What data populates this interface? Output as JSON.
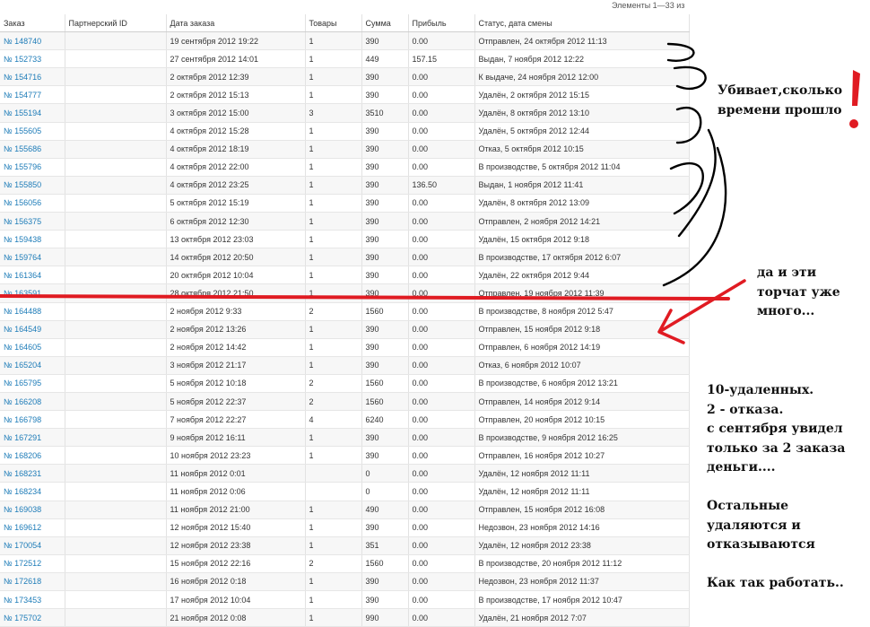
{
  "pager_text": "Элементы 1—33 из",
  "table": {
    "columns": [
      "Заказ",
      "Партнерский ID",
      "Дата заказа",
      "Товары",
      "Сумма",
      "Прибыль",
      "Статус, дата смены"
    ],
    "rows": [
      {
        "order": "№ 148740",
        "partner": "",
        "date": "19 сентября 2012 19:22",
        "items": "1",
        "sum": "390",
        "profit": "0.00",
        "status": "Отправлен, 24 октября 2012 11:13"
      },
      {
        "order": "№ 152733",
        "partner": "",
        "date": "27 сентября 2012 14:01",
        "items": "1",
        "sum": "449",
        "profit": "157.15",
        "status": "Выдан, 7 ноября 2012 12:22"
      },
      {
        "order": "№ 154716",
        "partner": "",
        "date": "2 октября 2012 12:39",
        "items": "1",
        "sum": "390",
        "profit": "0.00",
        "status": "К выдаче, 24 ноября 2012 12:00"
      },
      {
        "order": "№ 154777",
        "partner": "",
        "date": "2 октября 2012 15:13",
        "items": "1",
        "sum": "390",
        "profit": "0.00",
        "status": "Удалён, 2 октября 2012 15:15"
      },
      {
        "order": "№ 155194",
        "partner": "",
        "date": "3 октября 2012 15:00",
        "items": "3",
        "sum": "3510",
        "profit": "0.00",
        "status": "Удалён, 8 октября 2012 13:10"
      },
      {
        "order": "№ 155605",
        "partner": "",
        "date": "4 октября 2012 15:28",
        "items": "1",
        "sum": "390",
        "profit": "0.00",
        "status": "Удалён, 5 октября 2012 12:44"
      },
      {
        "order": "№ 155686",
        "partner": "",
        "date": "4 октября 2012 18:19",
        "items": "1",
        "sum": "390",
        "profit": "0.00",
        "status": "Отказ, 5 октября 2012 10:15"
      },
      {
        "order": "№ 155796",
        "partner": "",
        "date": "4 октября 2012 22:00",
        "items": "1",
        "sum": "390",
        "profit": "0.00",
        "status": "В производстве, 5 октября 2012 11:04"
      },
      {
        "order": "№ 155850",
        "partner": "",
        "date": "4 октября 2012 23:25",
        "items": "1",
        "sum": "390",
        "profit": "136.50",
        "status": "Выдан, 1 ноября 2012 11:41"
      },
      {
        "order": "№ 156056",
        "partner": "",
        "date": "5 октября 2012 15:19",
        "items": "1",
        "sum": "390",
        "profit": "0.00",
        "status": "Удалён, 8 октября 2012 13:09"
      },
      {
        "order": "№ 156375",
        "partner": "",
        "date": "6 октября 2012 12:30",
        "items": "1",
        "sum": "390",
        "profit": "0.00",
        "status": "Отправлен, 2 ноября 2012 14:21"
      },
      {
        "order": "№ 159438",
        "partner": "",
        "date": "13 октября 2012 23:03",
        "items": "1",
        "sum": "390",
        "profit": "0.00",
        "status": "Удалён, 15 октября 2012 9:18"
      },
      {
        "order": "№ 159764",
        "partner": "",
        "date": "14 октября 2012 20:50",
        "items": "1",
        "sum": "390",
        "profit": "0.00",
        "status": "В производстве, 17 октября 2012 6:07"
      },
      {
        "order": "№ 161364",
        "partner": "",
        "date": "20 октября 2012 10:04",
        "items": "1",
        "sum": "390",
        "profit": "0.00",
        "status": "Удалён, 22 октября 2012 9:44"
      },
      {
        "order": "№ 163591",
        "partner": "",
        "date": "28 октября 2012 21:50",
        "items": "1",
        "sum": "390",
        "profit": "0.00",
        "status": "Отправлен, 19 ноября 2012 11:39"
      },
      {
        "order": "№ 164488",
        "partner": "",
        "date": "2 ноября 2012 9:33",
        "items": "2",
        "sum": "1560",
        "profit": "0.00",
        "status": "В производстве, 8 ноября 2012 5:47"
      },
      {
        "order": "№ 164549",
        "partner": "",
        "date": "2 ноября 2012 13:26",
        "items": "1",
        "sum": "390",
        "profit": "0.00",
        "status": "Отправлен, 15 ноября 2012 9:18"
      },
      {
        "order": "№ 164605",
        "partner": "",
        "date": "2 ноября 2012 14:42",
        "items": "1",
        "sum": "390",
        "profit": "0.00",
        "status": "Отправлен, 6 ноября 2012 14:19"
      },
      {
        "order": "№ 165204",
        "partner": "",
        "date": "3 ноября 2012 21:17",
        "items": "1",
        "sum": "390",
        "profit": "0.00",
        "status": "Отказ, 6 ноября 2012 10:07"
      },
      {
        "order": "№ 165795",
        "partner": "",
        "date": "5 ноября 2012 10:18",
        "items": "2",
        "sum": "1560",
        "profit": "0.00",
        "status": "В производстве, 6 ноября 2012 13:21"
      },
      {
        "order": "№ 166208",
        "partner": "",
        "date": "5 ноября 2012 22:37",
        "items": "2",
        "sum": "1560",
        "profit": "0.00",
        "status": "Отправлен, 14 ноября 2012 9:14"
      },
      {
        "order": "№ 166798",
        "partner": "",
        "date": "7 ноября 2012 22:27",
        "items": "4",
        "sum": "6240",
        "profit": "0.00",
        "status": "Отправлен, 20 ноября 2012 10:15"
      },
      {
        "order": "№ 167291",
        "partner": "",
        "date": "9 ноября 2012 16:11",
        "items": "1",
        "sum": "390",
        "profit": "0.00",
        "status": "В производстве, 9 ноября 2012 16:25"
      },
      {
        "order": "№ 168206",
        "partner": "",
        "date": "10 ноября 2012 23:23",
        "items": "1",
        "sum": "390",
        "profit": "0.00",
        "status": "Отправлен, 16 ноября 2012 10:27"
      },
      {
        "order": "№ 168231",
        "partner": "",
        "date": "11 ноября 2012 0:01",
        "items": "",
        "sum": "0",
        "profit": "0.00",
        "status": "Удалён, 12 ноября 2012 11:11"
      },
      {
        "order": "№ 168234",
        "partner": "",
        "date": "11 ноября 2012 0:06",
        "items": "",
        "sum": "0",
        "profit": "0.00",
        "status": "Удалён, 12 ноября 2012 11:11"
      },
      {
        "order": "№ 169038",
        "partner": "",
        "date": "11 ноября 2012 21:00",
        "items": "1",
        "sum": "490",
        "profit": "0.00",
        "status": "Отправлен, 15 ноября 2012 16:08"
      },
      {
        "order": "№ 169612",
        "partner": "",
        "date": "12 ноября 2012 15:40",
        "items": "1",
        "sum": "390",
        "profit": "0.00",
        "status": "Недозвон, 23 ноября 2012 14:16"
      },
      {
        "order": "№ 170054",
        "partner": "",
        "date": "12 ноября 2012 23:38",
        "items": "1",
        "sum": "351",
        "profit": "0.00",
        "status": "Удалён, 12 ноября 2012 23:38"
      },
      {
        "order": "№ 172512",
        "partner": "",
        "date": "15 ноября 2012 22:16",
        "items": "2",
        "sum": "1560",
        "profit": "0.00",
        "status": "В производстве, 20 ноября 2012 11:12"
      },
      {
        "order": "№ 172618",
        "partner": "",
        "date": "16 ноября 2012 0:18",
        "items": "1",
        "sum": "390",
        "profit": "0.00",
        "status": "Недозвон, 23 ноября 2012 11:37"
      },
      {
        "order": "№ 173453",
        "partner": "",
        "date": "17 ноября 2012 10:04",
        "items": "1",
        "sum": "390",
        "profit": "0.00",
        "status": "В производстве, 17 ноября 2012 10:47"
      },
      {
        "order": "№ 175702",
        "partner": "",
        "date": "21 ноября 2012 0:08",
        "items": "1",
        "sum": "990",
        "profit": "0.00",
        "status": "Удалён, 21 ноября 2012 7:07"
      }
    ]
  },
  "annotations": {
    "top": "Убивает,сколько\nвремени прошло",
    "mid": "да и эти\nторчат уже\nмного...",
    "bottom": "10-удаленных.\n2 - отказа.\nс сентября увидел\nтолько за 2 заказа\nденьги....\n\nОстальные\nудаляются и\nотказываются\n\nКак так работать..",
    "mark_color": "#e01b22"
  }
}
